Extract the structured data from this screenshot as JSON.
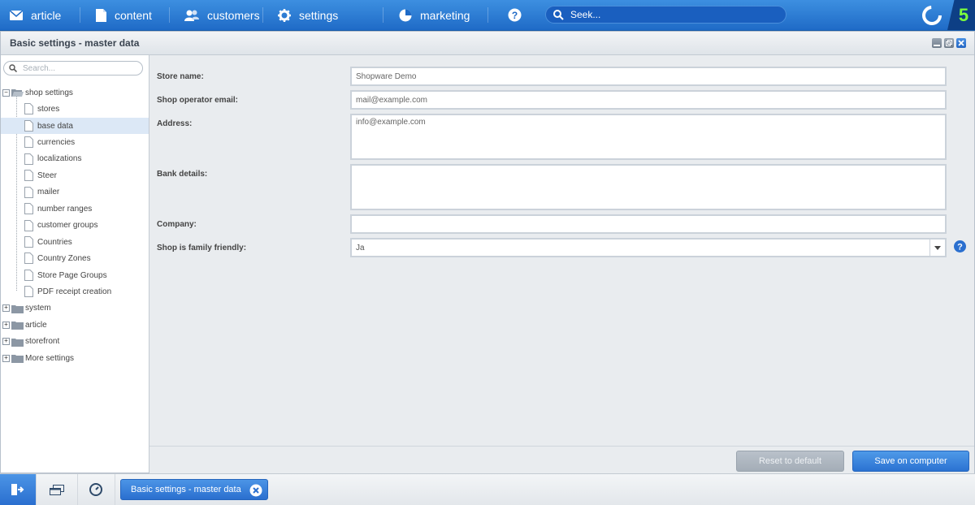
{
  "nav": {
    "items": [
      {
        "label": "article",
        "icon": "envelope-icon"
      },
      {
        "label": "content",
        "icon": "document-icon"
      },
      {
        "label": "customers",
        "icon": "users-icon"
      },
      {
        "label": "settings",
        "icon": "gear-icon"
      },
      {
        "label": "marketing",
        "icon": "pie-chart-icon"
      }
    ],
    "help_icon": "question-icon",
    "search_placeholder": "Seek...",
    "logo_text": "5",
    "accent": "#2a6fcf"
  },
  "window": {
    "title": "Basic settings - master data"
  },
  "tree": {
    "search_placeholder": "Search...",
    "root_expanded": {
      "label": "shop settings",
      "children": [
        "stores",
        "base data",
        "currencies",
        "localizations",
        "Steer",
        "mailer",
        "number ranges",
        "customer groups",
        "Countries",
        "Country Zones",
        "Store Page Groups",
        "PDF receipt creation"
      ],
      "selected": "base data"
    },
    "collapsed_roots": [
      "system",
      "article",
      "storefront",
      "More settings"
    ]
  },
  "form": {
    "store_name": {
      "label": "Store name:",
      "value": "Shopware Demo"
    },
    "operator_email": {
      "label": "Shop operator email:",
      "value": "mail@example.com"
    },
    "address": {
      "label": "Address:",
      "value": "info@example.com"
    },
    "bank_details": {
      "label": "Bank details:",
      "value": ""
    },
    "company": {
      "label": "Company:",
      "value": ""
    },
    "family_friendly": {
      "label": "Shop is family friendly:",
      "value": "Ja"
    }
  },
  "buttons": {
    "reset": "Reset to default",
    "save": "Save on computer"
  },
  "taskbar": {
    "task_label": "Basic settings - master data"
  }
}
